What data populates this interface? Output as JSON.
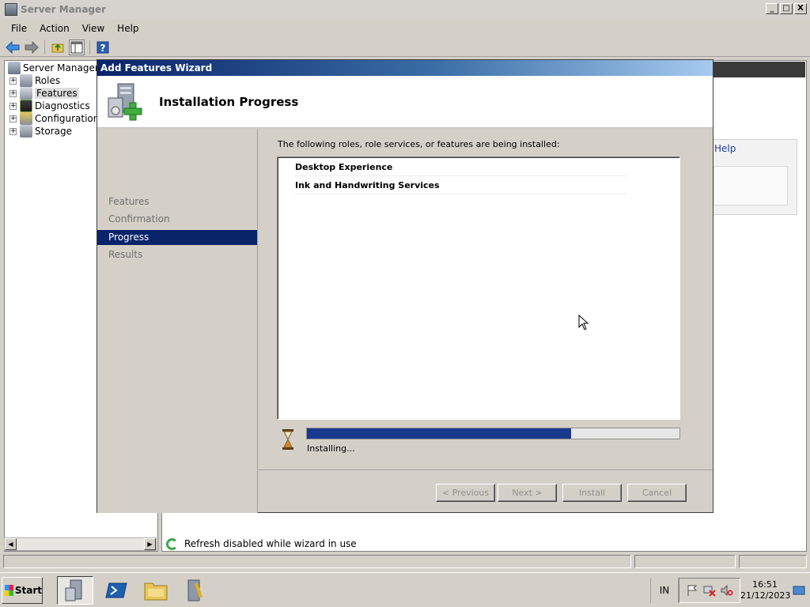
{
  "window": {
    "title": "Server Manager",
    "minimize": "_",
    "maximize": "□",
    "close": "X"
  },
  "menu": [
    "File",
    "Action",
    "View",
    "Help"
  ],
  "tree": {
    "root": "Server Manager (W",
    "items": [
      "Roles",
      "Features",
      "Diagnostics",
      "Configuration",
      "Storage"
    ],
    "selected": "Features",
    "expander": "+"
  },
  "right_pane": {
    "help_link": "Help",
    "status_text": "Refresh disabled while wizard in use"
  },
  "wizard": {
    "title": "Add Features Wizard",
    "heading": "Installation Progress",
    "nav": [
      "Features",
      "Confirmation",
      "Progress",
      "Results"
    ],
    "active_step": "Progress",
    "intro": "The following roles, role services, or features are being installed:",
    "items": [
      "Desktop Experience",
      "Ink and Handwriting Services"
    ],
    "progress": 0.71,
    "progress_text": "Installing...",
    "buttons": {
      "previous": "< Previous",
      "next": "Next >",
      "install": "Install",
      "cancel": "Cancel"
    }
  },
  "taskbar": {
    "start": "Start",
    "apps": [
      "server-manager-icon",
      "powershell-icon",
      "explorer-icon",
      "admin-tools-icon"
    ],
    "language": "IN",
    "time": "16:51",
    "date": "21/12/2023"
  },
  "colors": {
    "title_gradient_start": "#0a246a",
    "nav_active": "#0a246a",
    "progress_fill": "#1a3a8e"
  }
}
